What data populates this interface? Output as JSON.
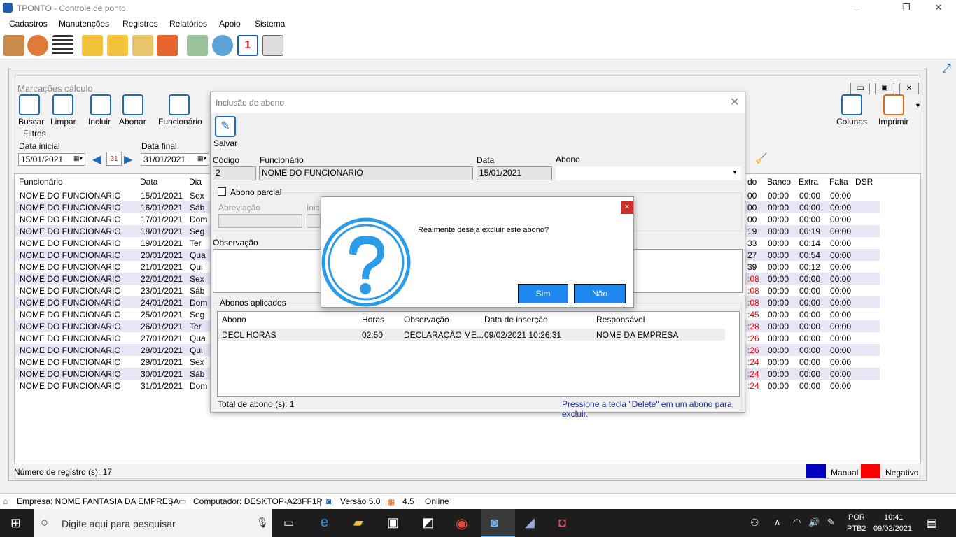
{
  "window": {
    "title": "TPONTO - Controle de ponto"
  },
  "menu": [
    "Cadastros",
    "Manutenções",
    "Registros",
    "Relatórios",
    "Apoio",
    "Sistema"
  ],
  "child": {
    "title": "Marcações cálculo",
    "buttons": [
      "Buscar",
      "Limpar",
      "Incluir",
      "Abonar",
      "Funcionário"
    ],
    "right_buttons": [
      "Colunas",
      "Imprimir"
    ],
    "filters_label": "Filtros",
    "date_start_label": "Data inicial",
    "date_start": "15/01/2021",
    "date_end_label": "Data final",
    "date_end": "31/01/2021",
    "calendar_day": "31",
    "columns": [
      "Funcionário",
      "Data",
      "Dia"
    ],
    "right_columns": [
      "do",
      "Banco",
      "Extra",
      "Falta",
      "DSR"
    ],
    "rows": [
      [
        "NOME DO FUNCIONARIO",
        "15/01/2021",
        "Sex",
        "00",
        "00:00",
        "00:00",
        "00:00"
      ],
      [
        "NOME DO FUNCIONARIO",
        "16/01/2021",
        "Sáb",
        "00",
        "00:00",
        "00:00",
        "00:00"
      ],
      [
        "NOME DO FUNCIONARIO",
        "17/01/2021",
        "Dom",
        "00",
        "00:00",
        "00:00",
        "00:00"
      ],
      [
        "NOME DO FUNCIONARIO",
        "18/01/2021",
        "Seg",
        "19",
        "00:00",
        "00:19",
        "00:00"
      ],
      [
        "NOME DO FUNCIONARIO",
        "19/01/2021",
        "Ter",
        "33",
        "00:00",
        "00:14",
        "00:00"
      ],
      [
        "NOME DO FUNCIONARIO",
        "20/01/2021",
        "Qua",
        "27",
        "00:00",
        "00:54",
        "00:00"
      ],
      [
        "NOME DO FUNCIONARIO",
        "21/01/2021",
        "Qui",
        "39",
        "00:00",
        "00:12",
        "00:00"
      ],
      [
        "NOME DO FUNCIONARIO",
        "22/01/2021",
        "Sex",
        ":08",
        "00:00",
        "00:00",
        "00:00"
      ],
      [
        "NOME DO FUNCIONARIO",
        "23/01/2021",
        "Sáb",
        ":08",
        "00:00",
        "00:00",
        "00:00"
      ],
      [
        "NOME DO FUNCIONARIO",
        "24/01/2021",
        "Dom",
        ":08",
        "00:00",
        "00:00",
        "00:00"
      ],
      [
        "NOME DO FUNCIONARIO",
        "25/01/2021",
        "Seg",
        ":45",
        "00:00",
        "00:00",
        "00:00"
      ],
      [
        "NOME DO FUNCIONARIO",
        "26/01/2021",
        "Ter",
        ":28",
        "00:00",
        "00:00",
        "00:00"
      ],
      [
        "NOME DO FUNCIONARIO",
        "27/01/2021",
        "Qua",
        ":26",
        "00:00",
        "00:00",
        "00:00"
      ],
      [
        "NOME DO FUNCIONARIO",
        "28/01/2021",
        "Qui",
        ":26",
        "00:00",
        "00:00",
        "00:00"
      ],
      [
        "NOME DO FUNCIONARIO",
        "29/01/2021",
        "Sex",
        ":24",
        "00:00",
        "00:00",
        "00:00"
      ],
      [
        "NOME DO FUNCIONARIO",
        "30/01/2021",
        "Sáb",
        ":24",
        "00:00",
        "00:00",
        "00:00"
      ],
      [
        "NOME DO FUNCIONARIO",
        "31/01/2021",
        "Dom",
        ":24",
        "00:00",
        "00:00",
        "00:00"
      ]
    ],
    "record_count": "Número de registro (s): 17",
    "legend_manual": "Manual",
    "legend_negative": "Negativo",
    "colors": {
      "manual": "#0000c0",
      "negative": "#ff0000",
      "row_alt": "#e6e6f5",
      "accent": "#1e87ef"
    }
  },
  "dialog": {
    "title": "Inclusão de abono",
    "save": "Salvar",
    "code_label": "Código",
    "code": "2",
    "employee_label": "Funcionário",
    "employee": "NOME DO FUNCIONARIO",
    "date_label": "Data",
    "date": "15/01/2021",
    "abono_label": "Abono",
    "partial_label": "Abono parcial",
    "abbr_label": "Abreviação",
    "start_label": "Inic",
    "obs_label": "Observação",
    "applied_label": "Abonos aplicados",
    "applied_cols": [
      "Abono",
      "Horas",
      "Observação",
      "Data de inserção",
      "Responsável"
    ],
    "applied_row": [
      "DECL HORAS",
      "02:50",
      "DECLARAÇÃO ME...",
      "09/02/2021 10:26:31",
      "NOME DA EMPRESA"
    ],
    "total": "Total de abono (s): 1",
    "hint": "Pressione a tecla \"Delete\" em um abono para excluir."
  },
  "msgbox": {
    "text": "Realmente deseja excluir este abono?",
    "yes": "Sim",
    "no": "Não",
    "close": "×"
  },
  "status": {
    "company": "Empresa: NOME FANTASIA DA EMPRESA",
    "computer": "Computador: DESKTOP-A23FF1P",
    "version": "Versão 5.0",
    "db": "4.5",
    "online": "Online"
  },
  "taskbar": {
    "search": "Digite aqui para pesquisar",
    "lang1": "POR",
    "lang2": "PTB2",
    "time": "10:41",
    "date": "09/02/2021"
  }
}
